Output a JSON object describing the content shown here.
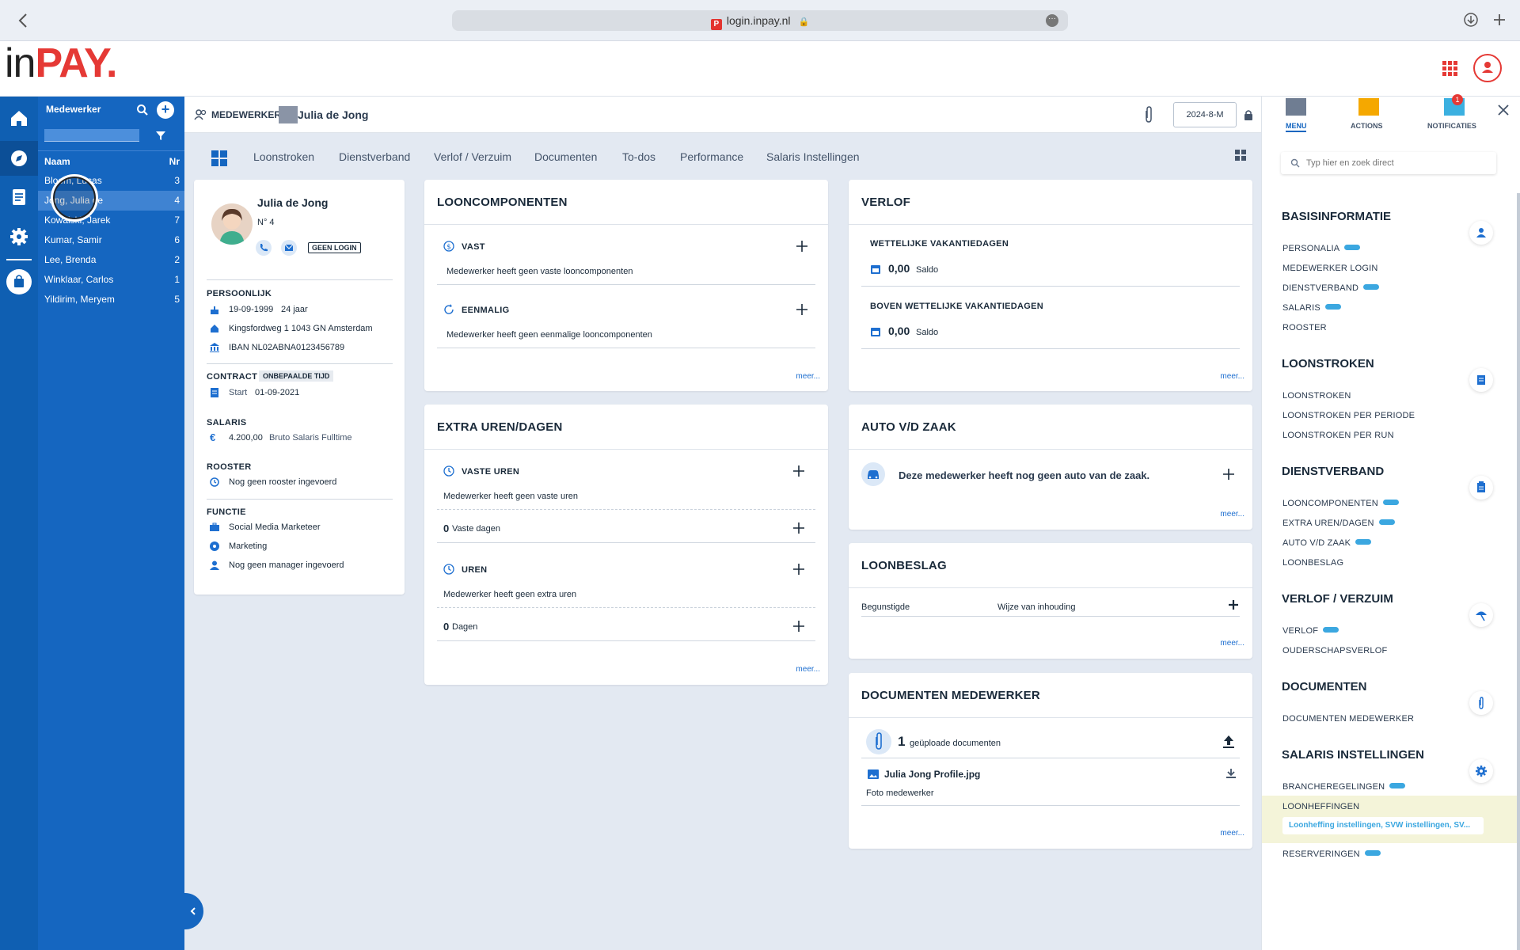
{
  "browser": {
    "url": "login.inpay.nl"
  },
  "brand": {
    "logo_in": "in",
    "logo_pay": "PAY",
    "accent": "#e53935",
    "primary": "#1566c0"
  },
  "emplist": {
    "title": "Medewerker",
    "col_name": "Naam",
    "col_nr": "Nr",
    "items": [
      {
        "name": "Bloem, Lucas",
        "nr": "3"
      },
      {
        "name": "Jong, Julia de",
        "nr": "4"
      },
      {
        "name": "Kowalski, Jarek",
        "nr": "7"
      },
      {
        "name": "Kumar, Samir",
        "nr": "6"
      },
      {
        "name": "Lee, Brenda",
        "nr": "2"
      },
      {
        "name": "Winklaar, Carlos",
        "nr": "1"
      },
      {
        "name": "Yildirim, Meryem",
        "nr": "5"
      }
    ]
  },
  "crumb": {
    "section": "MEDEWERKER",
    "name": "Julia de Jong",
    "period": "2024-8-M"
  },
  "tabs": [
    "Loonstroken",
    "Dienstverband",
    "Verlof / Verzuim",
    "Documenten",
    "To-dos",
    "Performance",
    "Salaris Instellingen"
  ],
  "profile": {
    "name": "Julia de Jong",
    "nr": "N° 4",
    "login_badge": "GEEN LOGIN",
    "persoonlijk_h": "PERSOONLIJK",
    "birth": "19-09-1999",
    "age": "24 jaar",
    "address": "Kingsfordweg 1 1043 GN Amsterdam",
    "iban": "IBAN NL02ABNA0123456789",
    "contract_h": "CONTRACT",
    "contract_badge": "ONBEPAALDE TIJD",
    "start_label": "Start",
    "start_date": "01-09-2021",
    "salaris_h": "SALARIS",
    "salary": "4.200,00",
    "salary_desc": "Bruto Salaris Fulltime",
    "rooster_h": "ROOSTER",
    "rooster": "Nog geen rooster ingevoerd",
    "functie_h": "FUNCTIE",
    "functie": "Social Media Marketeer",
    "afdeling": "Marketing",
    "manager": "Nog geen manager ingevoerd"
  },
  "looncomp": {
    "title": "LOONCOMPONENTEN",
    "vast_h": "VAST",
    "vast_txt": "Medewerker heeft geen vaste looncomponenten",
    "eenmalig_h": "EENMALIG",
    "eenmalig_txt": "Medewerker heeft geen eenmalige looncomponenten",
    "meer": "meer..."
  },
  "verlof": {
    "title": "VERLOF",
    "wettelijk_h": "WETTELIJKE VAKANTIEDAGEN",
    "wettelijk_val": "0,00",
    "saldo": "Saldo",
    "boven_h": "BOVEN WETTELIJKE VAKANTIEDAGEN",
    "boven_val": "0,00",
    "meer": "meer..."
  },
  "extra": {
    "title": "EXTRA UREN/DAGEN",
    "vaste_h": "VASTE UREN",
    "vaste_txt": "Medewerker heeft geen vaste uren",
    "vaste_dagen_n": "0",
    "vaste_dagen": "Vaste dagen",
    "uren_h": "UREN",
    "uren_txt": "Medewerker heeft geen extra uren",
    "dagen_n": "0",
    "dagen": "Dagen",
    "meer": "meer..."
  },
  "auto": {
    "title": "AUTO V/D ZAAK",
    "txt": "Deze medewerker heeft nog geen auto van de zaak.",
    "meer": "meer..."
  },
  "beslag": {
    "title": "LOONBESLAG",
    "col1": "Begunstigde",
    "col2": "Wijze van inhouding",
    "meer": "meer..."
  },
  "docs": {
    "title": "DOCUMENTEN MEDEWERKER",
    "count": "1",
    "count_txt": "geüploade documenten",
    "file": "Julia Jong Profile.jpg",
    "file_desc": "Foto medewerker",
    "meer": "meer..."
  },
  "rpanel": {
    "tab_menu": "MENU",
    "tab_actions": "ACTIONS",
    "tab_notif": "NOTIFICATIES",
    "notif_count": "1",
    "search_placeholder": "Typ hier en zoek direct",
    "basis_h": "BASISINFORMATIE",
    "personalia": "PERSONALIA",
    "login": "MEDEWERKER LOGIN",
    "dienstverband": "DIENSTVERBAND",
    "salaris": "SALARIS",
    "rooster": "ROOSTER",
    "loonstroken_h": "LOONSTROKEN",
    "loonstroken": "LOONSTROKEN",
    "per_periode": "LOONSTROKEN PER PERIODE",
    "per_run": "LOONSTROKEN PER RUN",
    "dienst_h": "DIENSTVERBAND",
    "looncomp": "LOONCOMPONENTEN",
    "extra": "EXTRA UREN/DAGEN",
    "auto": "AUTO V/D ZAAK",
    "beslag": "LOONBESLAG",
    "verlof_h": "VERLOF / VERZUIM",
    "verlof": "VERLOF",
    "ouderschap": "OUDERSCHAPSVERLOF",
    "doc_h": "DOCUMENTEN",
    "doc": "DOCUMENTEN MEDEWERKER",
    "sal_h": "SALARIS INSTELLINGEN",
    "branche": "BRANCHEREGELINGEN",
    "loonheffingen": "LOONHEFFINGEN",
    "loonheffingen_sub": "Loonheffing instellingen, SVW instellingen, SV...",
    "reserveringen": "RESERVERINGEN"
  }
}
